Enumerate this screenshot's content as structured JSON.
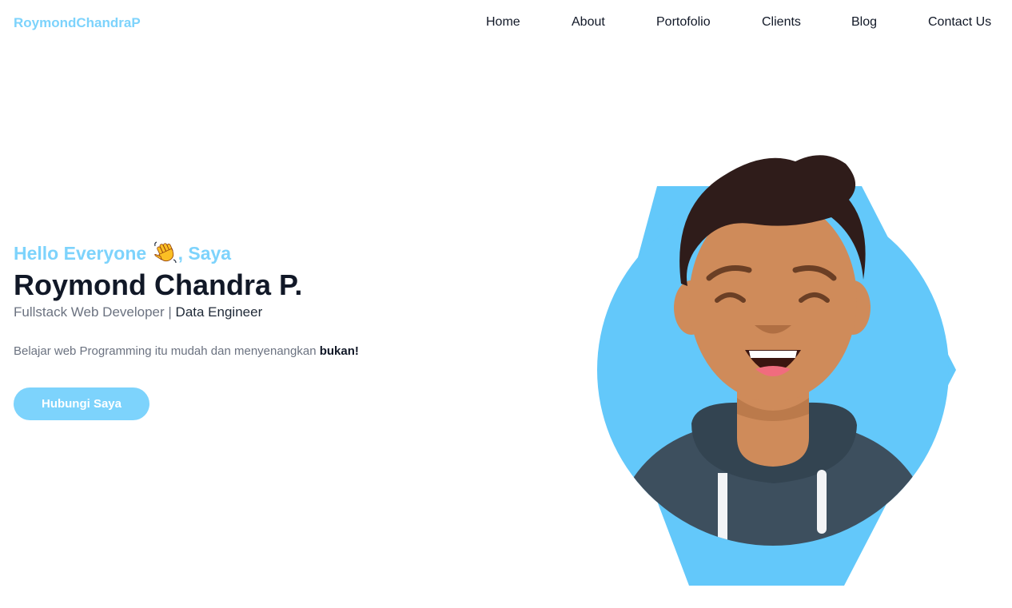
{
  "brand": {
    "name": "RoymondChandraP"
  },
  "nav": {
    "items": [
      {
        "label": "Home"
      },
      {
        "label": "About"
      },
      {
        "label": "Portofolio"
      },
      {
        "label": "Clients"
      },
      {
        "label": "Blog"
      },
      {
        "label": "Contact Us"
      }
    ]
  },
  "hero": {
    "greeting_before": "Hello Everyone",
    "greeting_after": ", Saya",
    "greeting_icon": "waving-hand-icon",
    "name": "Roymond Chandra P.",
    "role_primary": "Fullstack Web Developer",
    "role_separator": "|",
    "role_secondary": "Data Engineer",
    "tagline": "Belajar web Programming itu mudah dan menyenangkan",
    "tagline_bold": "bukan!",
    "cta_label": "Hubungi Saya",
    "illustration": "smiling-developer-avatar"
  },
  "colors": {
    "accent": "#7dd3fc",
    "avatar_background": "#63c8fa",
    "text_dark": "#111827",
    "text_muted": "#6b7280"
  }
}
